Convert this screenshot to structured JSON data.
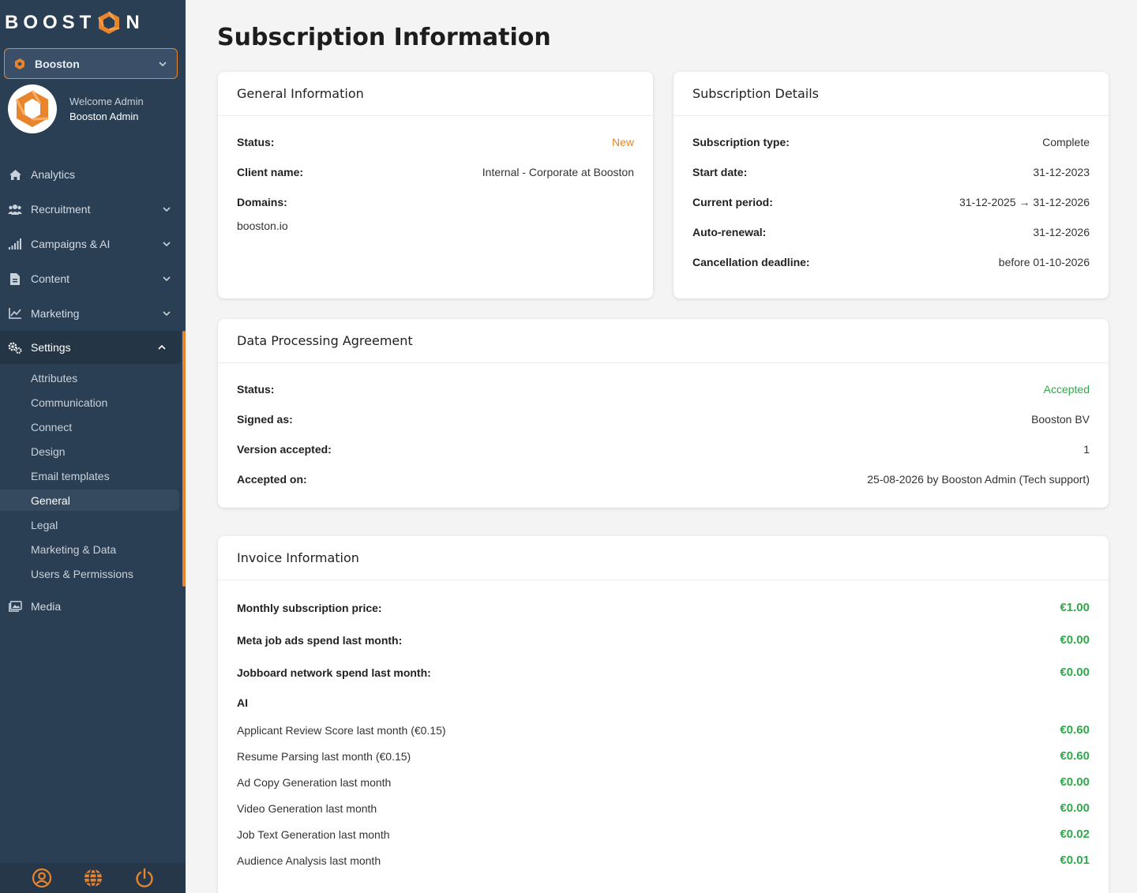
{
  "brand": {
    "logo_left": "BOOST",
    "logo_right": "N",
    "accent": "#e8842c",
    "sidebar_bg": "#2b3f54"
  },
  "org_selector": {
    "value": "Booston"
  },
  "user": {
    "welcome": "Welcome Admin",
    "name": "Booston Admin"
  },
  "nav": {
    "analytics": "Analytics",
    "recruitment": "Recruitment",
    "campaigns": "Campaigns & AI",
    "content": "Content",
    "marketing": "Marketing",
    "settings": "Settings",
    "media": "Media"
  },
  "settings_sub": [
    "Attributes",
    "Communication",
    "Connect",
    "Design",
    "Email templates",
    "General",
    "Legal",
    "Marketing & Data",
    "Users & Permissions"
  ],
  "page": {
    "title": "Subscription Information"
  },
  "general": {
    "title": "General Information",
    "status_label": "Status:",
    "status_value": "New",
    "client_label": "Client name:",
    "client_value": "Internal - Corporate at Booston",
    "domains_label": "Domains:",
    "domains_value": "booston.io"
  },
  "subscription": {
    "title": "Subscription Details",
    "type_label": "Subscription type:",
    "type_value": "Complete",
    "start_label": "Start date:",
    "start_value": "31-12-2023",
    "period_label": "Current period:",
    "period_value": "31-12-2025 → 31-12-2026",
    "renewal_label": "Auto-renewal:",
    "renewal_value": "31-12-2026",
    "cancel_label": "Cancellation deadline:",
    "cancel_value": "before 01-10-2026"
  },
  "dpa": {
    "title": "Data Processing Agreement",
    "status_label": "Status:",
    "status_value": "Accepted",
    "signed_label": "Signed as:",
    "signed_value": "Booston BV",
    "version_label": "Version accepted:",
    "version_value": "1",
    "accepted_label": "Accepted on:",
    "accepted_value": "25-08-2026 by Booston Admin (Tech support)"
  },
  "invoice": {
    "title": "Invoice Information",
    "monthly_label": "Monthly subscription price:",
    "monthly_value": "€1.00",
    "meta_label": "Meta job ads spend last month:",
    "meta_value": "€0.00",
    "jobboard_label": "Jobboard network spend last month:",
    "jobboard_value": "€0.00",
    "ai_section": "AI",
    "ai_items": [
      {
        "label": "Applicant Review Score last month (€0.15)",
        "value": "€0.60"
      },
      {
        "label": "Resume Parsing last month (€0.15)",
        "value": "€0.60"
      },
      {
        "label": "Ad Copy Generation last month",
        "value": "€0.00"
      },
      {
        "label": "Video Generation last month",
        "value": "€0.00"
      },
      {
        "label": "Job Text Generation last month",
        "value": "€0.02"
      },
      {
        "label": "Audience Analysis last month",
        "value": "€0.01"
      }
    ]
  }
}
